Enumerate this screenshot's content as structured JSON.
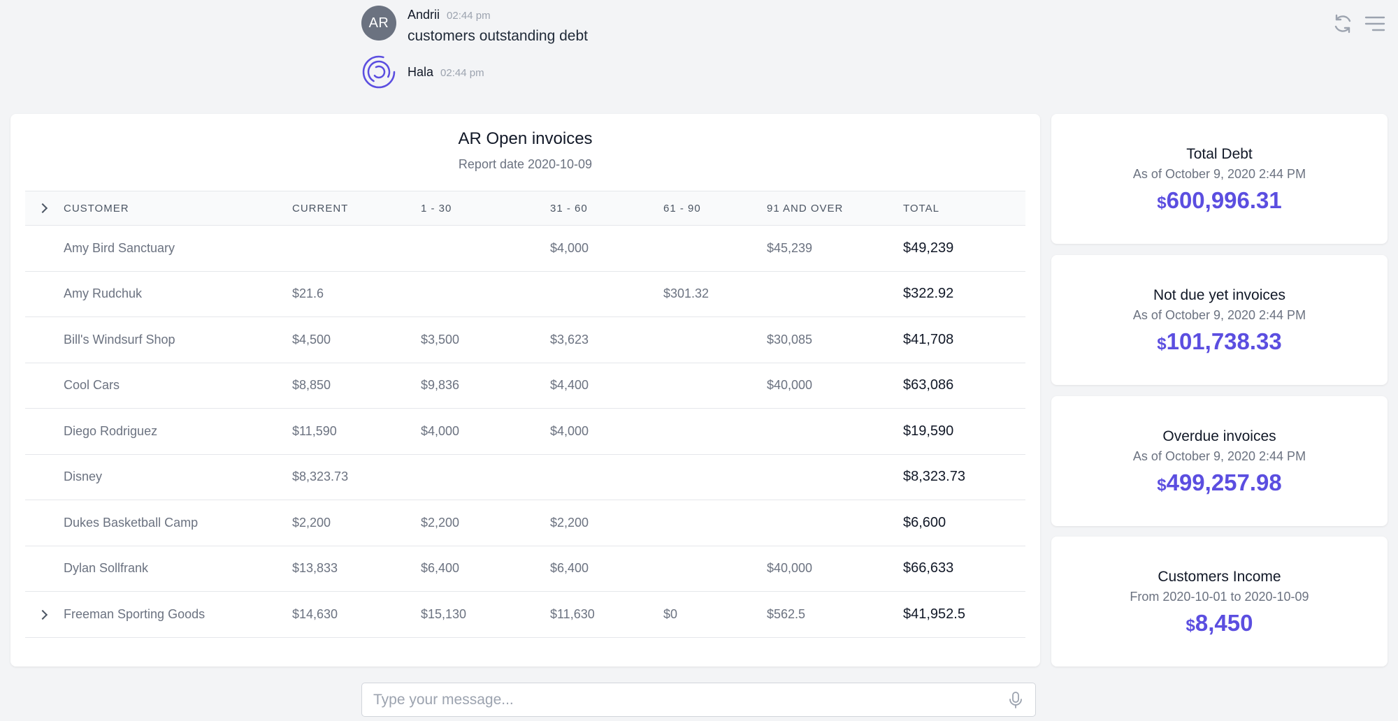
{
  "chat": {
    "user_message": {
      "avatar_initials": "AR",
      "author": "Andrii",
      "time": "02:44 pm",
      "text": "customers outstanding debt"
    },
    "bot_message": {
      "author": "Hala",
      "time": "02:44 pm"
    }
  },
  "icons": {
    "refresh": "refresh-icon",
    "menu": "menu-icon",
    "mic": "mic-icon",
    "expand": "chevron-right-icon"
  },
  "report": {
    "title": "AR Open invoices",
    "date": "Report date 2020-10-09",
    "columns": [
      "CUSTOMER",
      "CURRENT",
      "1 - 30",
      "31 - 60",
      "61 - 90",
      "91 AND OVER",
      "TOTAL"
    ],
    "rows": [
      {
        "customer": "Amy Bird Sanctuary",
        "current": "",
        "d1_30": "",
        "d31_60": "$4,000",
        "d61_90": "",
        "d91": "$45,239",
        "total": "$49,239"
      },
      {
        "customer": "Amy Rudchuk",
        "current": "$21.6",
        "d1_30": "",
        "d31_60": "",
        "d61_90": "$301.32",
        "d91": "",
        "total": "$322.92"
      },
      {
        "customer": "Bill's Windsurf Shop",
        "current": "$4,500",
        "d1_30": "$3,500",
        "d31_60": "$3,623",
        "d61_90": "",
        "d91": "$30,085",
        "total": "$41,708"
      },
      {
        "customer": "Cool Cars",
        "current": "$8,850",
        "d1_30": "$9,836",
        "d31_60": "$4,400",
        "d61_90": "",
        "d91": "$40,000",
        "total": "$63,086"
      },
      {
        "customer": "Diego Rodriguez",
        "current": "$11,590",
        "d1_30": "$4,000",
        "d31_60": "$4,000",
        "d61_90": "",
        "d91": "",
        "total": "$19,590"
      },
      {
        "customer": "Disney",
        "current": "$8,323.73",
        "d1_30": "",
        "d31_60": "",
        "d61_90": "",
        "d91": "",
        "total": "$8,323.73"
      },
      {
        "customer": "Dukes Basketball Camp",
        "current": "$2,200",
        "d1_30": "$2,200",
        "d31_60": "$2,200",
        "d61_90": "",
        "d91": "",
        "total": "$6,600"
      },
      {
        "customer": "Dylan Sollfrank",
        "current": "$13,833",
        "d1_30": "$6,400",
        "d31_60": "$6,400",
        "d61_90": "",
        "d91": "$40,000",
        "total": "$66,633"
      },
      {
        "customer": "Freeman Sporting Goods",
        "current": "$14,630",
        "d1_30": "$15,130",
        "d31_60": "$11,630",
        "d61_90": "$0",
        "d91": "$562.5",
        "total": "$41,952.5"
      }
    ]
  },
  "summary": [
    {
      "title": "Total Debt",
      "subtitle": "As of October 9, 2020 2:44 PM",
      "currency": "$",
      "value": "600,996.31"
    },
    {
      "title": "Not due yet invoices",
      "subtitle": "As of October 9, 2020 2:44 PM",
      "currency": "$",
      "value": "101,738.33"
    },
    {
      "title": "Overdue invoices",
      "subtitle": "As of October 9, 2020 2:44 PM",
      "currency": "$",
      "value": "499,257.98"
    },
    {
      "title": "Customers Income",
      "subtitle": "From 2020-10-01 to 2020-10-09",
      "currency": "$",
      "value": "8,450"
    }
  ],
  "input": {
    "placeholder": "Type your message..."
  },
  "colors": {
    "accent": "#5b4ee0",
    "background": "#f3f4f6",
    "avatar": "#6b7280"
  }
}
